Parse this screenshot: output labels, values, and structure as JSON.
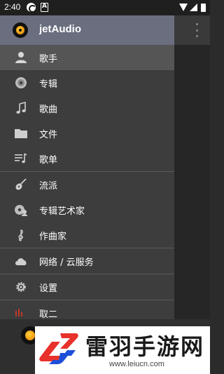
{
  "status_bar": {
    "time": "2:40",
    "icons": [
      "app-notification-icon",
      "font-app-icon",
      "wifi-icon",
      "signal-icon",
      "battery-icon"
    ]
  },
  "drawer": {
    "app_title": "jetAudio",
    "items": [
      {
        "label": "歌手",
        "icon": "person-icon",
        "active": true
      },
      {
        "label": "专辑",
        "icon": "disc-icon",
        "active": false
      },
      {
        "label": "歌曲",
        "icon": "music-note-icon",
        "active": false
      },
      {
        "label": "文件",
        "icon": "folder-icon",
        "active": false
      },
      {
        "label": "歌单",
        "icon": "playlist-icon",
        "active": false
      },
      {
        "label": "流派",
        "icon": "guitar-icon",
        "active": false
      },
      {
        "label": "专辑艺术家",
        "icon": "album-artist-icon",
        "active": false
      },
      {
        "label": "作曲家",
        "icon": "treble-clef-icon",
        "active": false
      },
      {
        "label": "网络 / 云服务",
        "icon": "cloud-icon",
        "active": false
      },
      {
        "label": "设置",
        "icon": "gear-icon",
        "active": false
      }
    ],
    "partial_item_label": "取二"
  },
  "watermark": {
    "title": "雷羽手游网",
    "url": "www.leiucn.com"
  },
  "colors": {
    "drawer_header": "#6a6e7f",
    "drawer_bg": "#3d3d3d",
    "active_item_bg": "#555555",
    "watermark_red": "#e8312b",
    "watermark_blue": "#1e4fd8"
  }
}
